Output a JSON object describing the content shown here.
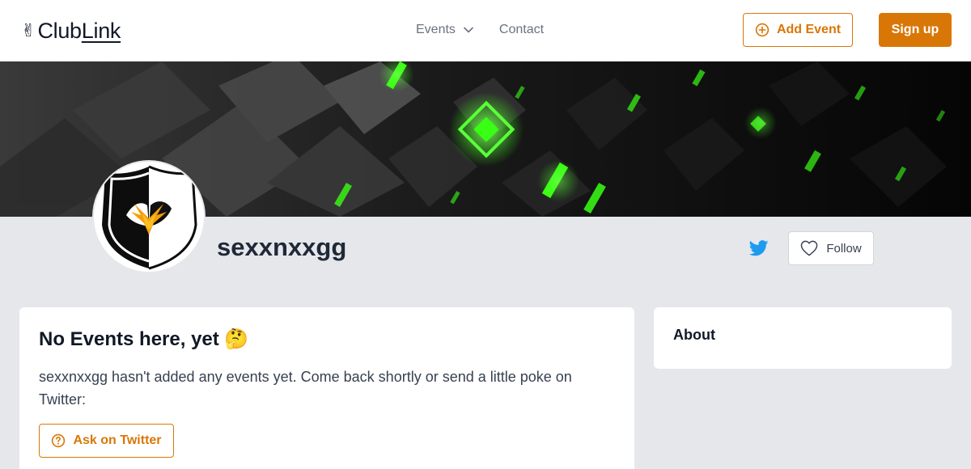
{
  "header": {
    "logo": {
      "emoji": "✌",
      "text_main": "Club",
      "text_link": "Link"
    },
    "nav": [
      {
        "label": "Events"
      },
      {
        "label": "Contact"
      }
    ],
    "add_event_label": "Add Event",
    "signup_label": "Sign up"
  },
  "profile": {
    "name": "sexxnxxgg",
    "follow_label": "Follow",
    "icons": {
      "twitter": "twitter-icon",
      "follow": "heart-icon"
    }
  },
  "events_card": {
    "title": "No Events here, yet 🤔",
    "message": "sexxnxxgg hasn't added any events yet. Come back shortly or send a little poke on Twitter:",
    "ask_label": "Ask on Twitter"
  },
  "about_card": {
    "title": "About"
  },
  "colors": {
    "accent": "#d97706",
    "twitter": "#1d9bf0",
    "page_bg": "#e5e7eb",
    "banner_green": "#39ff14"
  }
}
